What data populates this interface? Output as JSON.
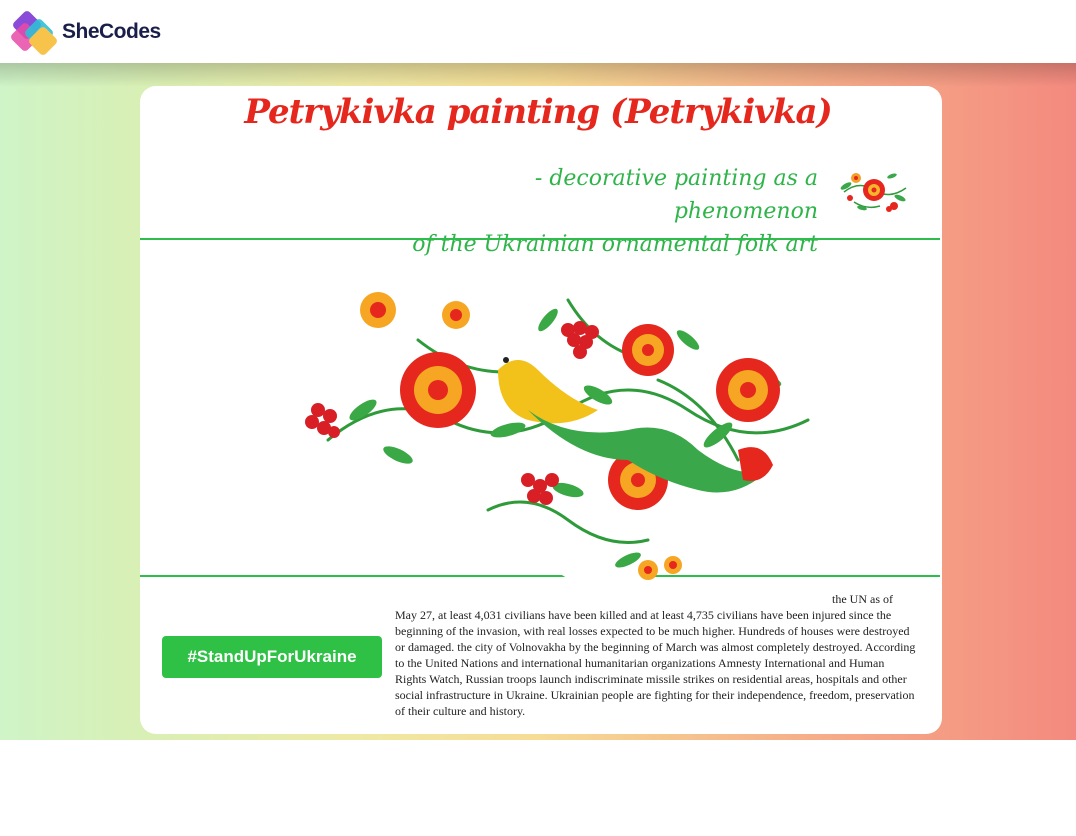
{
  "header": {
    "brand": "SheCodes",
    "logo_icon": "shecodes-logo-icon"
  },
  "hero": {
    "title": "Petrykivka painting (Petrykivka)",
    "subtitle_line1": "- decorative painting as a phenomenon",
    "subtitle_line2": "of the Ukrainian ornamental folk art",
    "corner_icon": "folk-flower-icon"
  },
  "cta": {
    "label": "#StandUpForUkraine"
  },
  "article": {
    "lead_in": "the UN as of",
    "body": "May 27, at least 4,031 civilians have been killed and at least 4,735 civilians have been injured since the beginning of the invasion, with real losses expected to be much higher. Hundreds of houses were destroyed or damaged. the city of Volnovakha by the beginning of March was almost completely destroyed. According to the United Nations and international humanitarian organizations Amnesty International and Human Rights Watch, Russian troops launch indiscriminate missile strikes on residential areas, hospitals and other social infrastructure in Ukraine. Ukrainian people are fighting for their independence, freedom, preservation of their culture and history."
  },
  "colors": {
    "title_red": "#e5271d",
    "accent_green": "#2ebd4a",
    "button_green": "#2ec145"
  }
}
